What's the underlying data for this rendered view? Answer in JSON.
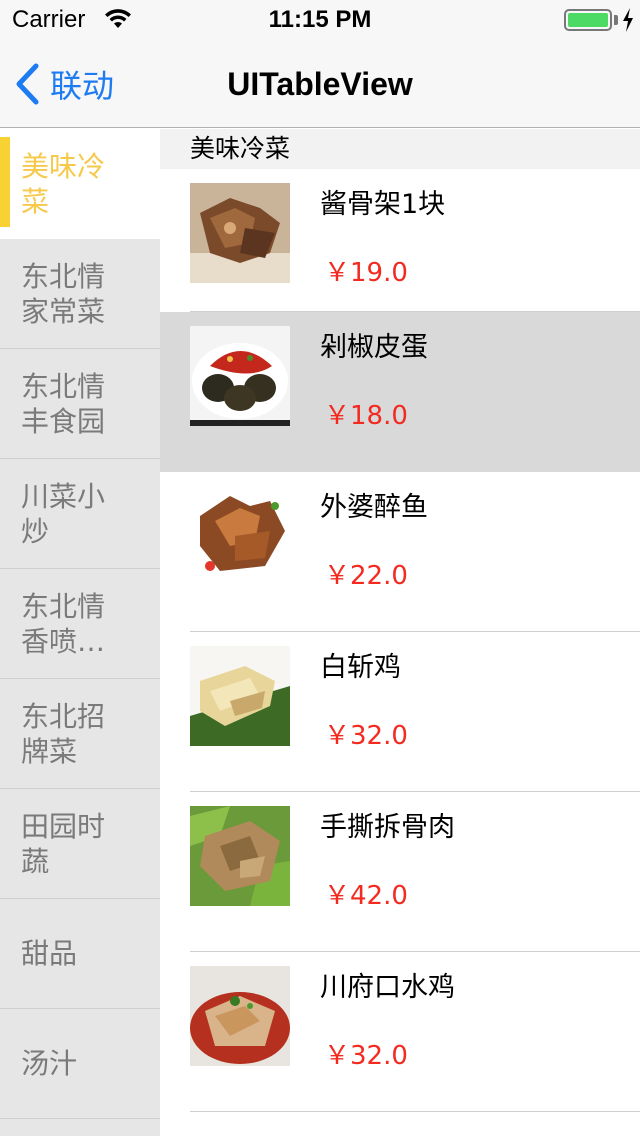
{
  "status_bar": {
    "carrier": "Carrier",
    "time": "11:15 PM",
    "battery_level": 1.0
  },
  "nav": {
    "back_label": "联动",
    "title": "UITableView"
  },
  "categories": [
    {
      "label": "美味冷菜",
      "selected": true
    },
    {
      "label": "东北情家常菜",
      "selected": false
    },
    {
      "label": "东北情丰食园",
      "selected": false
    },
    {
      "label": "川菜小炒",
      "selected": false
    },
    {
      "label": "东北情香喷…",
      "selected": false
    },
    {
      "label": "东北招牌菜",
      "selected": false
    },
    {
      "label": "田园时蔬",
      "selected": false
    },
    {
      "label": "甜品",
      "selected": false
    },
    {
      "label": "汤汁",
      "selected": false
    }
  ],
  "section": {
    "header": "美味冷菜",
    "items": [
      {
        "name": "酱骨架1块",
        "price": "￥19.0",
        "image": "pork-bone-image"
      },
      {
        "name": "剁椒皮蛋",
        "price": "￥18.0",
        "image": "chili-egg-image",
        "highlighted": true
      },
      {
        "name": "外婆醉鱼",
        "price": "￥22.0",
        "image": "drunken-fish-image"
      },
      {
        "name": "白斩鸡",
        "price": "￥32.0",
        "image": "white-chicken-image"
      },
      {
        "name": "手撕拆骨肉",
        "price": "￥42.0",
        "image": "shredded-meat-image"
      },
      {
        "name": "川府口水鸡",
        "price": "￥32.0",
        "image": "spicy-chicken-image"
      }
    ]
  },
  "colors": {
    "accent_blue": "#1e7cf2",
    "selected_yellow": "#f8d233",
    "price_red": "#f22a1f",
    "battery_green": "#4cd964"
  }
}
